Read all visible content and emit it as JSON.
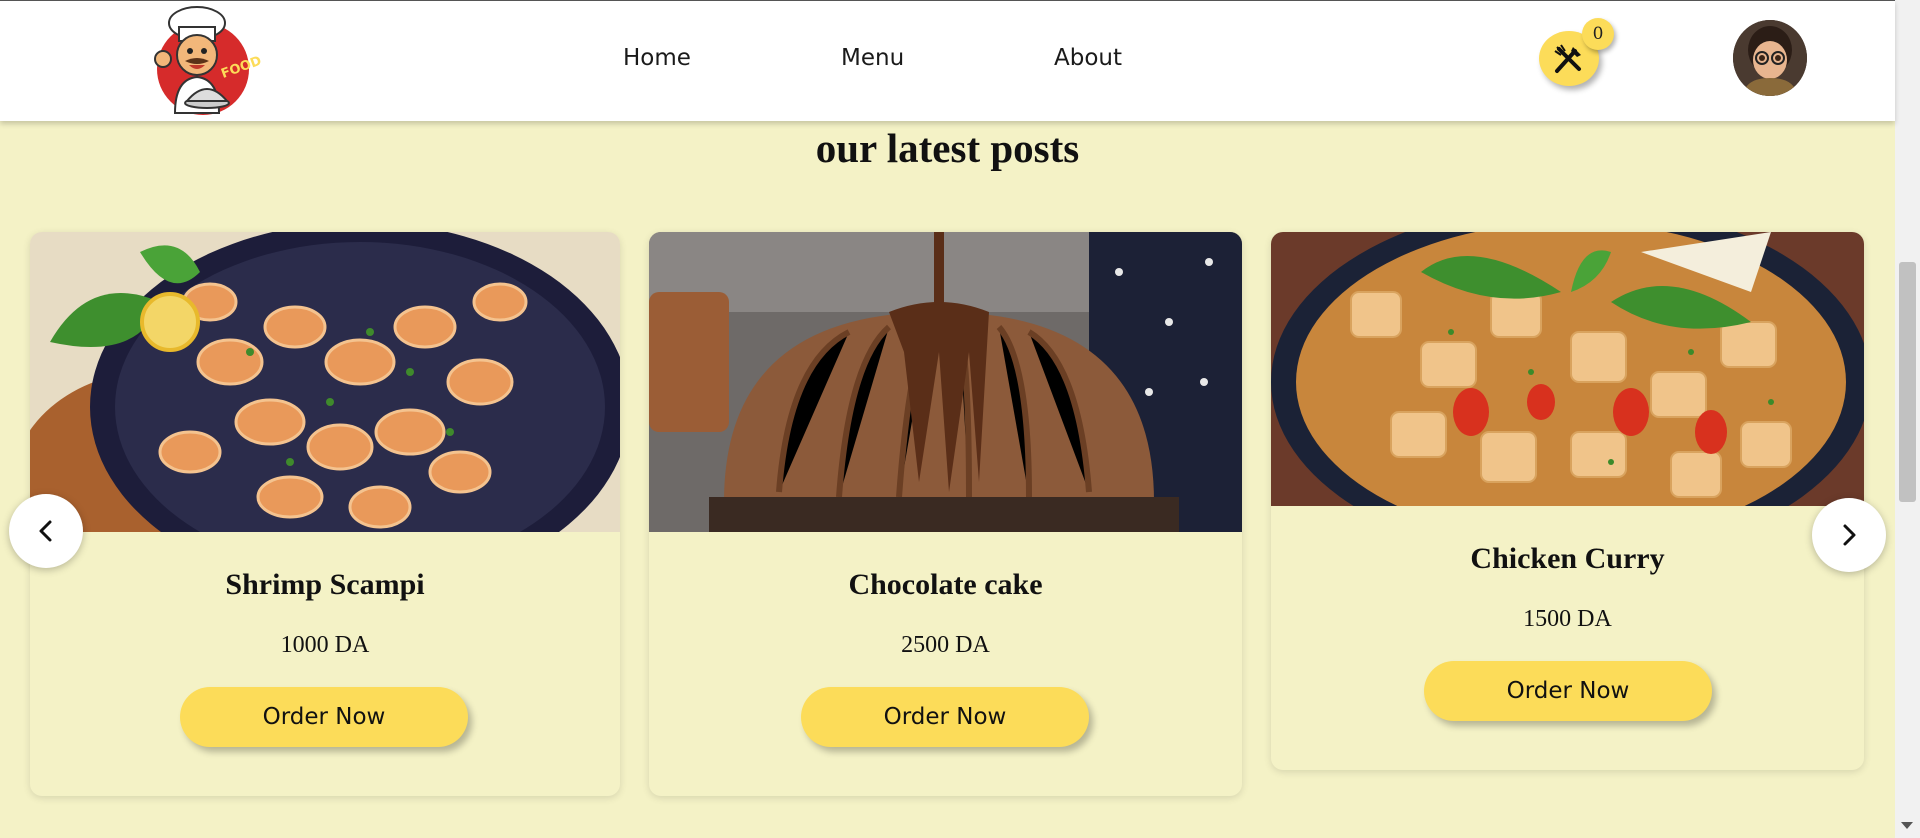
{
  "nav": {
    "home": "Home",
    "menu": "Menu",
    "about": "About"
  },
  "cart": {
    "count": "0"
  },
  "section": {
    "title": "our latest posts"
  },
  "cards": [
    {
      "name": "Shrimp Scampi",
      "price": "1000 DA",
      "button": "Order Now"
    },
    {
      "name": "Chocolate cake",
      "price": "2500 DA",
      "button": "Order Now"
    },
    {
      "name": "Chicken Curry",
      "price": "1500 DA",
      "button": "Order Now"
    }
  ],
  "logo": {
    "text": "FOOD"
  },
  "colors": {
    "accent": "#fcdc59",
    "background": "#f4f2c6",
    "header": "#ffffff"
  },
  "icons": {
    "cart": "fork-knife-icon",
    "prev": "chevron-left-icon",
    "next": "chevron-right-icon"
  }
}
